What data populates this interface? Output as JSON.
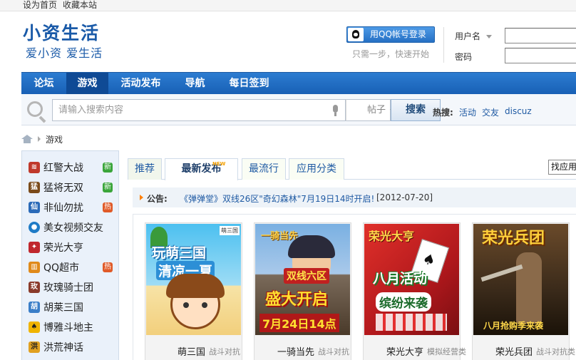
{
  "topbar": {
    "set_home": "设为首页",
    "bookmark": "收藏本站"
  },
  "logo": {
    "title": "小资生活",
    "slogan": "爱小资 爱生活"
  },
  "login": {
    "qq_button": "用QQ帐号登录",
    "qq_tip": "只需一步，快速开始",
    "username_label": "用户名",
    "password_label": "密码"
  },
  "nav": {
    "items": [
      {
        "label": "论坛",
        "active": false
      },
      {
        "label": "游戏",
        "active": true
      },
      {
        "label": "活动发布",
        "active": false
      },
      {
        "label": "导航",
        "active": false
      },
      {
        "label": "每日签到",
        "active": false
      }
    ]
  },
  "search": {
    "placeholder": "请输入搜索内容",
    "type_selected": "帖子",
    "button": "搜索",
    "hot_label": "热搜:",
    "hot_links": [
      "活动",
      "交友",
      "discuz"
    ]
  },
  "breadcrumb": {
    "current": "游戏"
  },
  "sidebar": {
    "items": [
      {
        "label": "红警大战",
        "icon": "red-alert-icon",
        "icon_color": "#c0392b",
        "badge": "新",
        "badge_color": "#3aa53a"
      },
      {
        "label": "猛将无双",
        "icon": "warrior-icon",
        "icon_color": "#7a4a1a",
        "badge": "新",
        "badge_color": "#3aa53a"
      },
      {
        "label": "非仙勿扰",
        "icon": "immortal-icon",
        "icon_color": "#2a6ab8",
        "badge": "热",
        "badge_color": "#e05a28"
      },
      {
        "label": "美女视频交友",
        "icon": "video-chat-icon",
        "icon_color": "#1e7bc6",
        "badge": "",
        "badge_color": ""
      },
      {
        "label": "荣光大亨",
        "icon": "tycoon-icon",
        "icon_color": "#c0272d",
        "badge": "",
        "badge_color": ""
      },
      {
        "label": "QQ超市",
        "icon": "supermarket-icon",
        "icon_color": "#e08a1a",
        "badge": "热",
        "badge_color": "#e05a28"
      },
      {
        "label": "玫瑰骑士团",
        "icon": "rose-knight-icon",
        "icon_color": "#8a3a2a",
        "badge": "",
        "badge_color": ""
      },
      {
        "label": "胡莱三国",
        "icon": "hulai-icon",
        "icon_color": "#3a7ec8",
        "badge": "",
        "badge_color": ""
      },
      {
        "label": "博雅斗地主",
        "icon": "doudizhu-icon",
        "icon_color": "#f0b400",
        "badge": "",
        "badge_color": ""
      },
      {
        "label": "洪荒神话",
        "icon": "myth-icon",
        "icon_color": "#e0a020",
        "badge": "",
        "badge_color": ""
      }
    ]
  },
  "tabs": {
    "items": [
      {
        "label": "推荐",
        "active": false
      },
      {
        "label": "最新发布",
        "active": true,
        "tag": "NEW"
      },
      {
        "label": "最流行",
        "active": false
      },
      {
        "label": "应用分类",
        "active": false
      }
    ],
    "find_app": "找应用"
  },
  "notice": {
    "label": "公告:",
    "text": "《弹弹堂》双线26区\"奇幻森林\"7月19日14时开启!",
    "date": "[2012-07-20]"
  },
  "games": [
    {
      "name": "萌三国",
      "category": "战斗对抗",
      "art_text": "玩萌三国",
      "art_text2": "清凉一夏",
      "art_color": "#3bb3e8"
    },
    {
      "name": "一骑当先",
      "category": "战斗对抗",
      "art_text": "双线六区",
      "art_text2": "盛大开启",
      "art_text3": "7月24日14点",
      "art_color": "#6a9fd6"
    },
    {
      "name": "荣光大亨",
      "category": "模拟经营类",
      "art_text": "荣光大亨",
      "art_text2": "八月活动",
      "art_text3": "缤纷来袭",
      "art_color": "#c0272d"
    },
    {
      "name": "荣光兵团",
      "category": "战斗对抗类",
      "art_text": "荣光兵团",
      "art_text2": "八月抢购季来袭",
      "art_color": "#5a3a20"
    }
  ]
}
